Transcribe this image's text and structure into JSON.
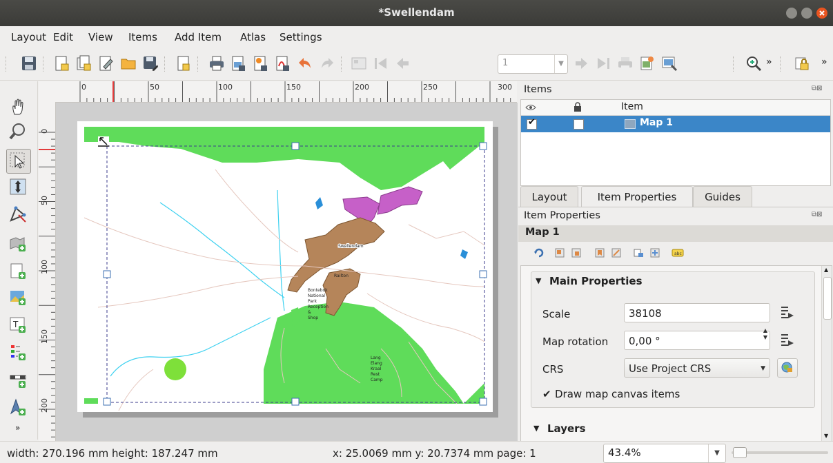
{
  "window": {
    "title": "*Swellendam"
  },
  "menubar": {
    "items": [
      {
        "label": "Layout"
      },
      {
        "label": "Edit"
      },
      {
        "label": "View"
      },
      {
        "label": "Items"
      },
      {
        "label": "Add Item"
      },
      {
        "label": "Atlas"
      },
      {
        "label": "Settings"
      }
    ]
  },
  "toolbar": {
    "page_value": "1",
    "icons": [
      "save-icon",
      "new-layout-icon",
      "duplicate-layout-icon",
      "layout-manager-icon",
      "open-template-icon",
      "save-template-icon",
      "new-page-icon",
      "print-icon",
      "export-image-icon",
      "export-svg-icon",
      "export-pdf-icon",
      "undo-icon",
      "redo-icon",
      "atlas-preview-icon",
      "first-feature-icon",
      "previous-feature-icon",
      "next-feature-icon",
      "last-feature-icon",
      "atlas-print-icon",
      "atlas-export-image-icon",
      "atlas-settings-icon",
      "zoom-in-icon",
      "lock-items-icon"
    ]
  },
  "ruler": {
    "h_labels": [
      "0",
      "50",
      "100",
      "150",
      "200",
      "250",
      "300"
    ],
    "v_labels": [
      "0",
      "50",
      "100",
      "150",
      "200"
    ]
  },
  "map": {
    "labels": {
      "swellendam": "Swellendam",
      "railton": "Railton",
      "bontebok": [
        "Bontebok",
        "National",
        "Park",
        "Reception",
        "&",
        "Shop"
      ],
      "lang": [
        "Lang",
        "Elang",
        "Kraal",
        "Rest",
        "Camp"
      ]
    }
  },
  "items_panel": {
    "title": "Items",
    "col_item": "Item",
    "rows": [
      {
        "visible": true,
        "locked": false,
        "name": "Map 1"
      }
    ]
  },
  "tabs": [
    {
      "label": "Layout",
      "active": false
    },
    {
      "label": "Item Properties",
      "active": true
    },
    {
      "label": "Guides",
      "active": false
    }
  ],
  "item_properties": {
    "title": "Item Properties",
    "item_name": "Map 1",
    "main_properties_title": "Main Properties",
    "scale_label": "Scale",
    "scale_value": "38108",
    "rotation_label": "Map rotation",
    "rotation_value": "0,00 °",
    "crs_label": "CRS",
    "crs_value": "Use Project CRS",
    "draw_items_label": "Draw map canvas items",
    "draw_items_checked": true,
    "layers_title": "Layers"
  },
  "statusbar": {
    "size_text": "width: 270.196 mm height: 187.247 mm",
    "coords_text": "x: 25.0069 mm  y: 20.7374 mm  page: 1",
    "zoom_value": "43.4%",
    "zoom_slider_fraction": 0.02
  },
  "colors": {
    "accent": "#e95420",
    "selection": "#3b86c8",
    "park_green": "#5fdc5a",
    "urban": "#b5855a",
    "magenta": "#c660c8"
  }
}
